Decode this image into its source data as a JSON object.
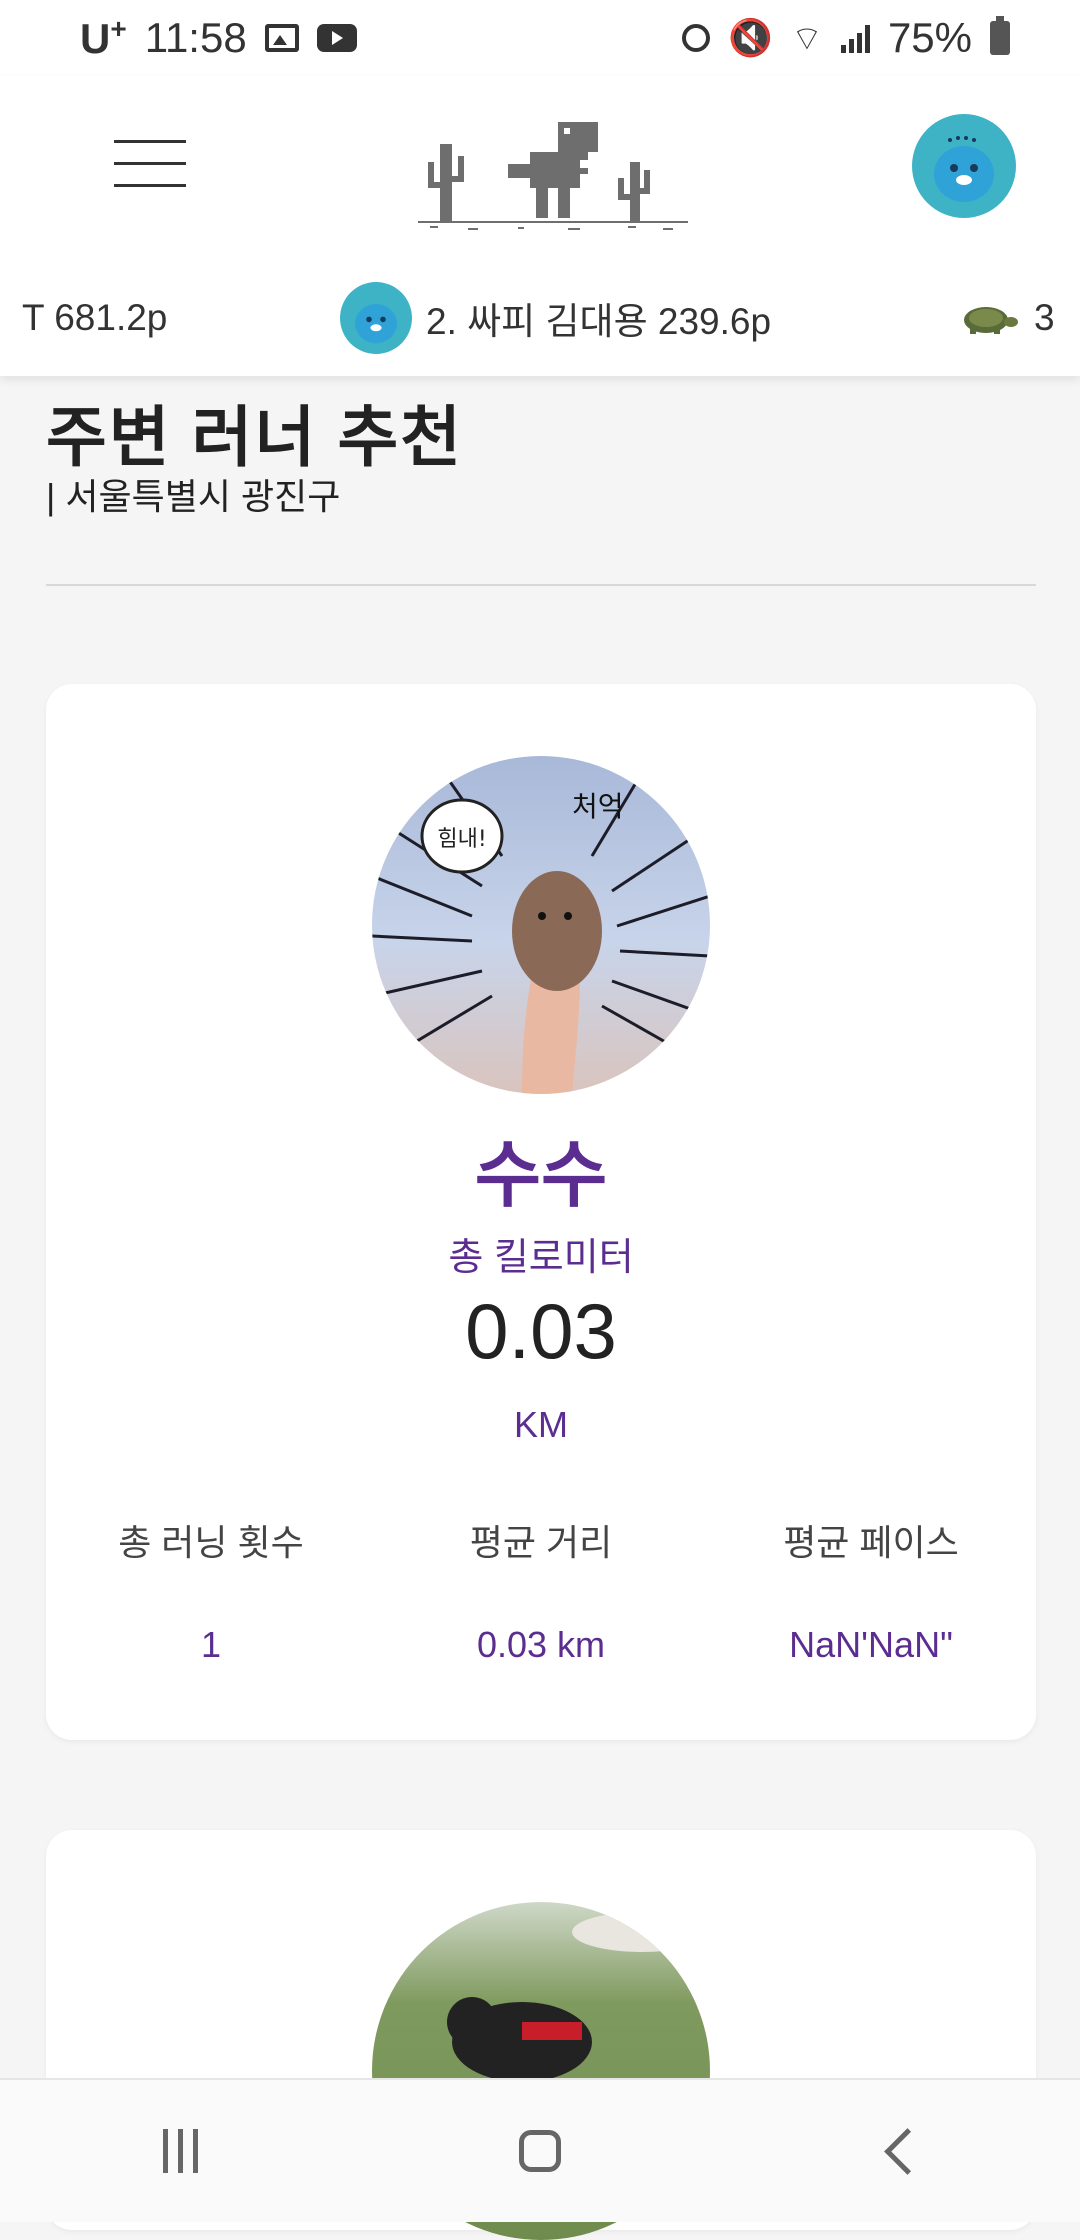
{
  "status_bar": {
    "carrier": "U",
    "carrier_sup": "+",
    "time": "11:58",
    "battery": "75%"
  },
  "ranking_ticker": [
    {
      "text": "T 681.2p"
    },
    {
      "text": "2. 싸피 김대용 239.6p"
    },
    {
      "text": "3"
    }
  ],
  "section": {
    "title": "주변 러너 추천",
    "location": "| 서울특별시 광진구"
  },
  "runner_card": {
    "profile_caption_bubble": "힘내!",
    "profile_caption_text": "처억",
    "name": "수수",
    "total_km_label": "총 킬로미터",
    "total_km_value": "0.03",
    "unit": "KM",
    "stats": [
      {
        "label": "총 러닝 횟수",
        "value": "1"
      },
      {
        "label": "평균 거리",
        "value": "0.03 km"
      },
      {
        "label": "평균 페이스",
        "value": "NaN'NaN\""
      }
    ]
  },
  "colors": {
    "accent": "#5b2d91",
    "avatar_bg": "#3fb3c6",
    "logo": "#6e6e6e"
  },
  "icons": [
    "menu-icon",
    "dino-logo",
    "turtle-icon",
    "recents-icon",
    "home-icon",
    "back-icon"
  ]
}
